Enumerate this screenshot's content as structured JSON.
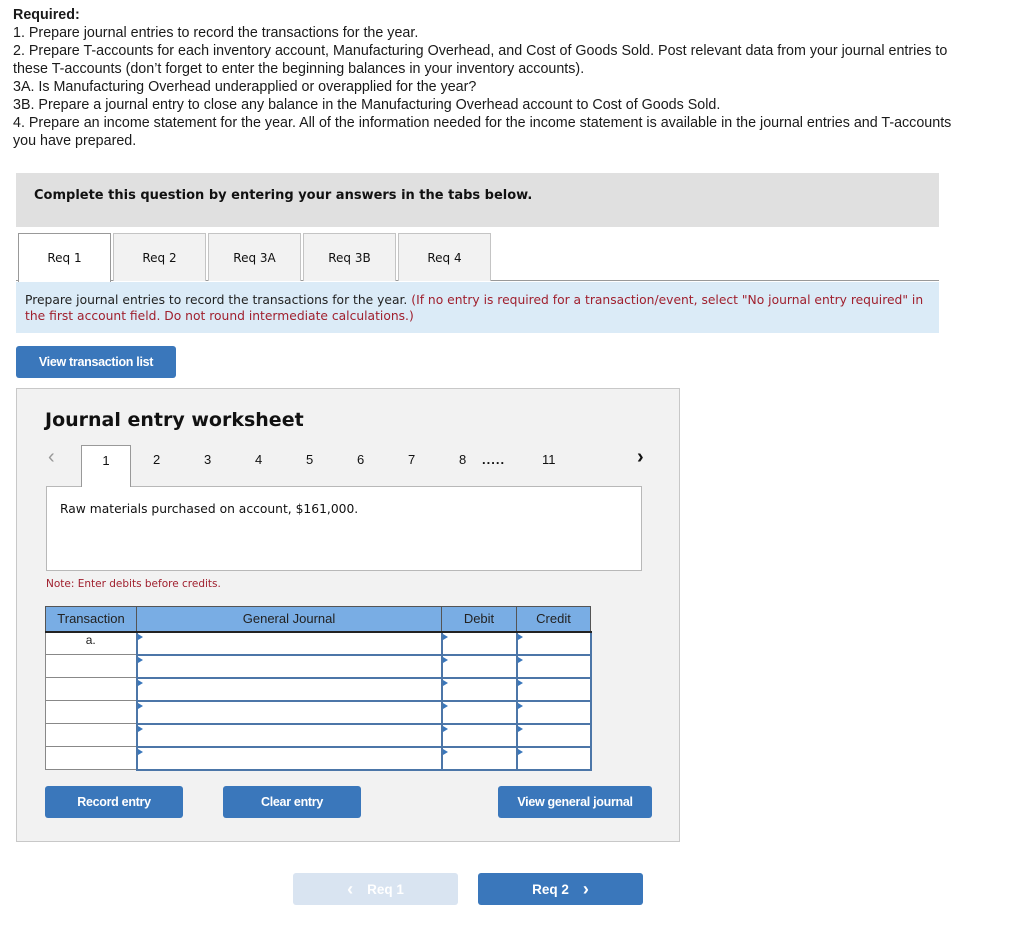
{
  "required": {
    "title": "Required:",
    "lines": [
      "1. Prepare journal entries to record the transactions for the year.",
      "2. Prepare T-accounts for each inventory account, Manufacturing Overhead, and Cost of Goods Sold. Post relevant data from your journal entries to these T-accounts (don’t forget to enter the beginning balances in your inventory accounts).",
      "3A. Is Manufacturing Overhead underapplied or overapplied for the year?",
      "3B. Prepare a journal entry to close any balance in the Manufacturing Overhead account to Cost of Goods Sold.",
      "4. Prepare an income statement for the year. All of the information needed for the income statement is available in the journal entries and T-accounts you have prepared."
    ]
  },
  "instruction_bar": "Complete this question by entering your answers in the tabs below.",
  "tabs": [
    {
      "label": "Req 1",
      "active": true
    },
    {
      "label": "Req 2",
      "active": false
    },
    {
      "label": "Req 3A",
      "active": false
    },
    {
      "label": "Req 3B",
      "active": false
    },
    {
      "label": "Req 4",
      "active": false
    }
  ],
  "prompt": {
    "main": "Prepare journal entries to record the transactions for the year.",
    "note": "(If no entry is required for a transaction/event, select \"No journal entry required\" in the first account field. Do not round intermediate calculations.)"
  },
  "view_transaction_list_label": "View transaction list",
  "worksheet": {
    "title": "Journal entry worksheet",
    "pages": [
      "1",
      "2",
      "3",
      "4",
      "5",
      "6",
      "7",
      "8",
      ".....",
      "11"
    ],
    "active_page": "1",
    "prev_icon": "‹",
    "next_icon": "›",
    "description": "Raw materials purchased on account, $161,000.",
    "note": "Note: Enter debits before credits.",
    "table": {
      "headers": [
        "Transaction",
        "General Journal",
        "Debit",
        "Credit"
      ],
      "rows": [
        {
          "transaction": "a.",
          "account": "",
          "debit": "",
          "credit": ""
        },
        {
          "transaction": "",
          "account": "",
          "debit": "",
          "credit": ""
        },
        {
          "transaction": "",
          "account": "",
          "debit": "",
          "credit": ""
        },
        {
          "transaction": "",
          "account": "",
          "debit": "",
          "credit": ""
        },
        {
          "transaction": "",
          "account": "",
          "debit": "",
          "credit": ""
        },
        {
          "transaction": "",
          "account": "",
          "debit": "",
          "credit": ""
        }
      ]
    },
    "buttons": {
      "record": "Record entry",
      "clear": "Clear entry",
      "view_journal": "View general journal"
    }
  },
  "navigation": {
    "prev_label": "Req 1",
    "next_label": "Req 2",
    "prev_icon": "‹",
    "next_icon": "›"
  },
  "colors": {
    "button_blue": "#3a77bb",
    "disabled_blue": "#d9e4f1",
    "header_blue": "#79ade4",
    "prompt_bg": "#dbebf7",
    "red_text": "#a0202e"
  }
}
